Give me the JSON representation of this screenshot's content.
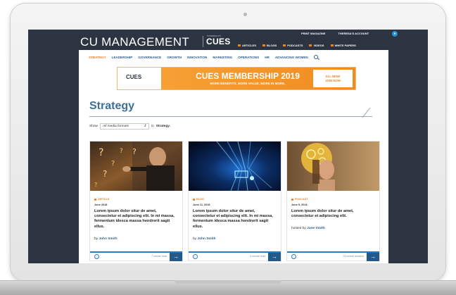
{
  "site": {
    "logo_primary": "CU MANAGEMENT",
    "logo_powered_by": "POWERED BY",
    "logo_secondary": "CUES"
  },
  "top_links": [
    "PRINT MAGAZINE",
    "THERESA'S ACCOUNT"
  ],
  "utility_nav": [
    "ARTICLES",
    "BLOGS",
    "PODCASTS",
    "VIDEOS",
    "WHITE PAPERS"
  ],
  "main_nav": [
    "STRATEGY",
    "LEADERSHIP",
    "GOVERNANCE",
    "GROWTH",
    "INNOVATION",
    "MARKETING",
    "OPERATIONS",
    "HR",
    "ADVANCING WOMEN"
  ],
  "banner": {
    "logo": "CUES",
    "title": "CUES MEMBERSHIP 2019",
    "subtitle": "MORE BENEFITS. MORE VALUE. MORE IN MORE.",
    "cta_line1": "ALL NEW!",
    "cta_line2": "JOIN NOW"
  },
  "page": {
    "title": "Strategy",
    "filter_prefix": "Show",
    "filter_value": "All media formats",
    "filter_suffix": "in",
    "filter_scope": "Strategy."
  },
  "cards": [
    {
      "type": "ARTICLE",
      "date": "June 2018",
      "headline": "Lorem ipsum dolor situr de amet, consectetur et adipiscing elit. In mi massa, fermentum idesca massa hendrerit sagit ellus.",
      "by_label": "by",
      "author": "John Smith",
      "read_time": "7 minute read"
    },
    {
      "type": "BLOG",
      "date": "June 11, 2018",
      "headline": "Lorem ipsum dolor situr de amet, consectetur et adipiscing elit. In mi massa, fermentum idesca massa hendrerit sagit ellus.",
      "by_label": "by",
      "author": "John Smith",
      "read_time": "4 minute read"
    },
    {
      "type": "PODCAST",
      "date": "June 9, 2018",
      "headline": "Lorem ipsum dolor situr de amet, consectetur et adipiscing elit.",
      "by_label": "hosted by",
      "author": "Jane Smith",
      "read_time": "24 minute duration"
    }
  ],
  "colors": {
    "navy": "#2c3442",
    "orange": "#f07f1d",
    "blue": "#2d5f8e",
    "title_blue": "#3f6f98"
  },
  "icons": {
    "account": "user-circle-icon",
    "search": "search-icon",
    "share": "share-icon",
    "arrow": "arrow-right-icon"
  }
}
